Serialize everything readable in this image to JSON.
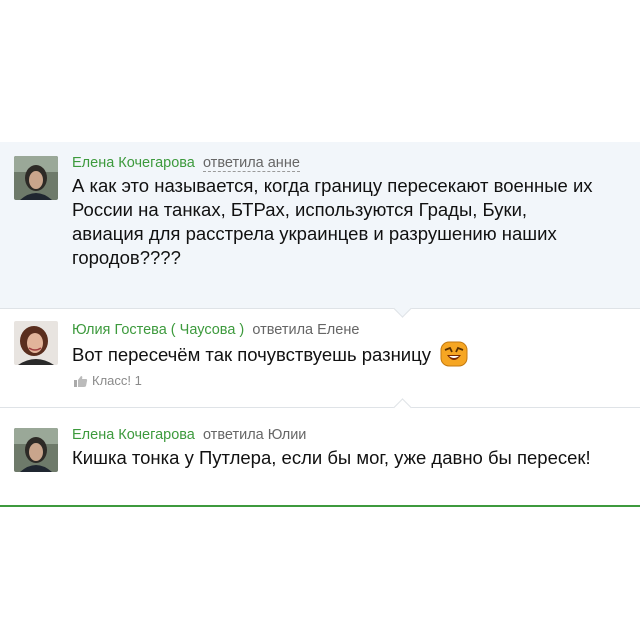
{
  "comments": [
    {
      "author": "Елена Кочегарова",
      "reply_to": "ответила анне",
      "lines": [
        "А как это называется, когда границу пересекают военные их",
        "России на танках, БТРах, используются  Грады, Буки,",
        "авиация для расстрела украинцев и разрушению наших",
        "городов????"
      ],
      "avatar": "avatar-woman-dark-hair"
    },
    {
      "author": "Юлия Гостева ( Чаусова )",
      "reply_to": "ответила Елене",
      "text": "Вот пересечём так почувствуешь разницу",
      "emoji": "laughing-emoji-icon",
      "likes_label": "Класс! 1",
      "avatar": "avatar-woman-smiling"
    },
    {
      "author": "Елена Кочегарова",
      "reply_to": "ответила Юлии",
      "text": "Кишка тонка у Путлера, если бы мог, уже давно бы пересек!",
      "avatar": "avatar-woman-dark-hair"
    }
  ],
  "colors": {
    "author": "#3d9a3d",
    "highlight_bg": "#f2f6fa",
    "divider": "#dfe3e7",
    "bottom_line": "#3d9a3d"
  }
}
